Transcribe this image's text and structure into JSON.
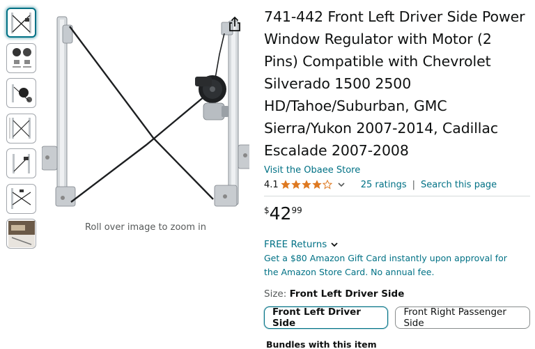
{
  "thumbnails": [
    {
      "name": "thumb-regulator-front",
      "selected": true
    },
    {
      "name": "thumb-motor-pins",
      "selected": false
    },
    {
      "name": "thumb-motor-detail",
      "selected": false
    },
    {
      "name": "thumb-regulator-dims",
      "selected": false
    },
    {
      "name": "thumb-regulator-side",
      "selected": false
    },
    {
      "name": "thumb-regulator-installed",
      "selected": false
    },
    {
      "name": "thumb-installation",
      "selected": false
    }
  ],
  "image": {
    "zoom_hint": "Roll over image to zoom in"
  },
  "product": {
    "title": "741-442 Front Left Driver Side Power Window Regulator with Motor (2 Pins) Compatible with Chevrolet Silverado 1500 2500 HD/Tahoe/Suburban, GMC Sierra/Yukon 2007-2014, Cadillac Escalade 2007-2008",
    "store_link": "Visit the Obaee Store",
    "rating_value": "4.1",
    "stars": 4.1,
    "ratings_count": "25 ratings",
    "separator": "|",
    "search_link": "Search this page",
    "price_symbol": "$",
    "price_whole": "42",
    "price_fraction": "99",
    "returns": "FREE Returns",
    "offer": "Get a $80 Amazon Gift Card instantly upon approval for the Amazon Store Card. No annual fee.",
    "size_label": "Size:",
    "size_value": "Front Left Driver Side",
    "size_options": [
      "Front Left Driver Side",
      "Front Right Passenger Side"
    ],
    "bundles_heading": "Bundles with this item"
  },
  "colors": {
    "link": "#007185",
    "star": "#de7921",
    "text": "#0f1111",
    "muted": "#565959"
  }
}
